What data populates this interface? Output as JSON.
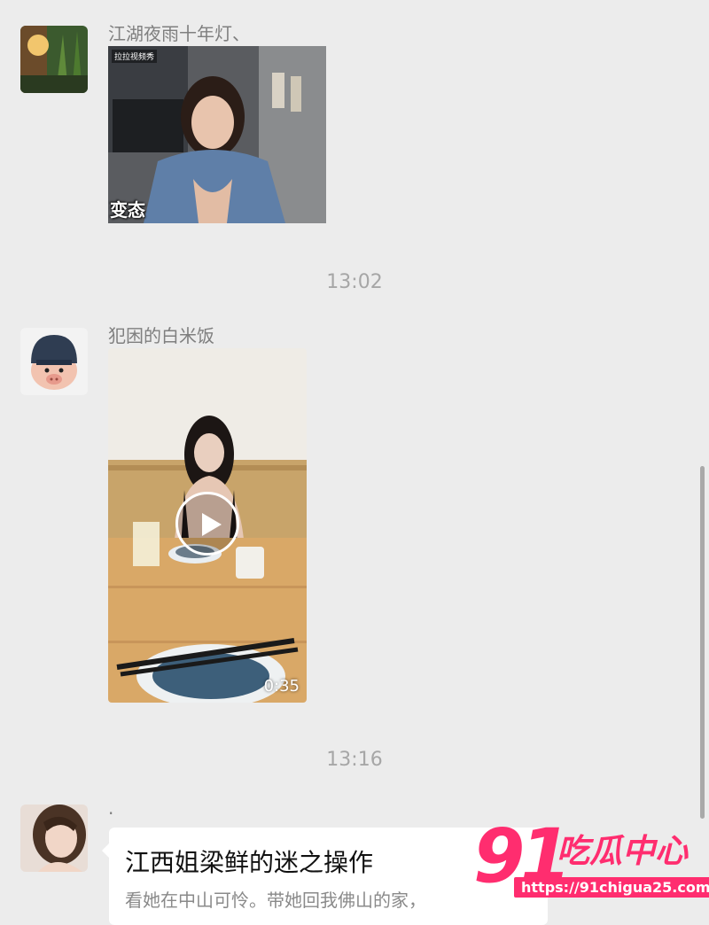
{
  "messages": [
    {
      "sender": "江湖夜雨十年灯、",
      "gif_tag": "拉拉视频秀",
      "gif_caption": "变态"
    },
    {
      "timestamp": "13:02",
      "sender": "犯困的白米饭",
      "video_duration": "0:35"
    },
    {
      "timestamp": "13:16",
      "sender": ".",
      "link_title": "江西姐梁鲜的迷之操作",
      "link_desc": "看她在中山可怜。带她回我佛山的家，"
    }
  ],
  "watermark": {
    "number": "91",
    "name": "吃瓜中心",
    "url": "https://91chigua25.com"
  },
  "icons": {
    "play": "play-icon",
    "scroll": "scrollbar"
  },
  "colors": {
    "background": "#ececec",
    "sender_text": "#7f7f7f",
    "timestamp_text": "#a6a6a6",
    "watermark": "#ff2d6f"
  }
}
